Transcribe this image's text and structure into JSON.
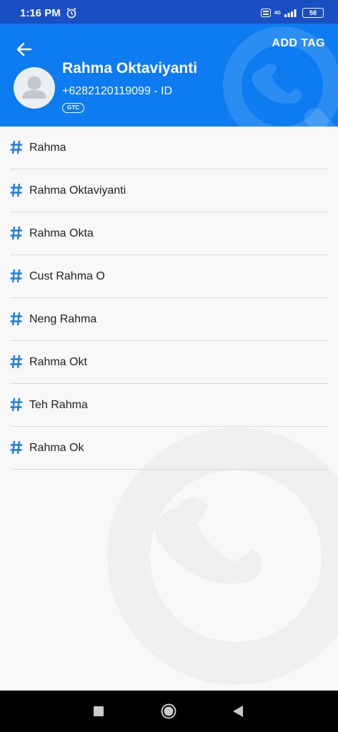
{
  "status_bar": {
    "time": "1:16 PM",
    "battery": "58",
    "network": "4G"
  },
  "header": {
    "action_label": "ADD TAG",
    "contact_name": "Rahma Oktaviyanti",
    "contact_phone": "+6282120119099 - ID",
    "badge": "GTC"
  },
  "tags": [
    {
      "label": "Rahma"
    },
    {
      "label": "Rahma Oktaviyanti"
    },
    {
      "label": "Rahma Okta"
    },
    {
      "label": "Cust Rahma O"
    },
    {
      "label": "Neng Rahma"
    },
    {
      "label": "Rahma Okt"
    },
    {
      "label": "Teh Rahma"
    },
    {
      "label": "Rahma Ok"
    }
  ],
  "colors": {
    "status_bar": "#1a4fc4",
    "header": "#0c7cf0",
    "accent": "#1f7ee0",
    "background": "#f8f8f8"
  },
  "icons": {
    "back": "arrow-left-icon",
    "tag": "hash-icon",
    "avatar": "person-icon",
    "alarm": "alarm-icon"
  }
}
